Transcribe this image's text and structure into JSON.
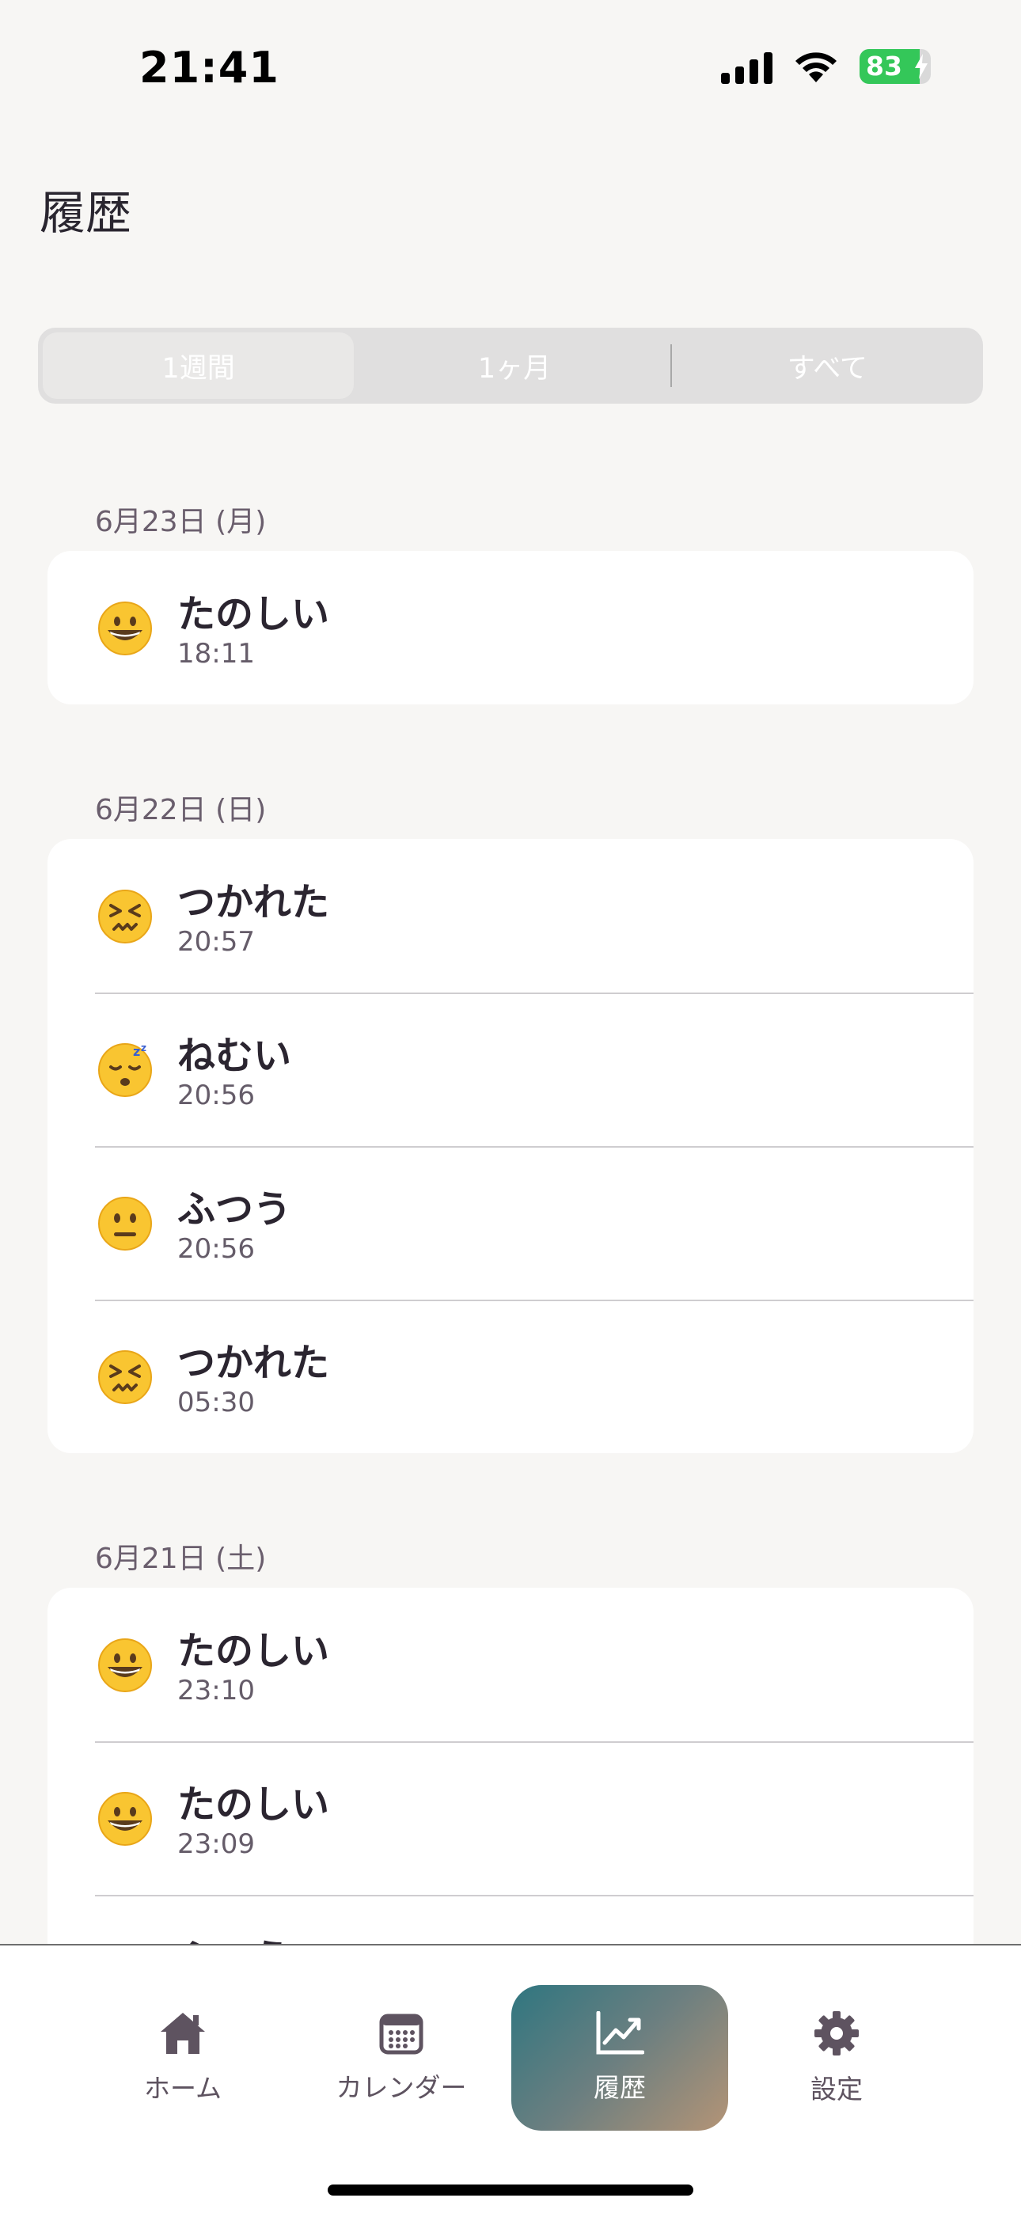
{
  "status_bar": {
    "time": "21:41",
    "battery": "83"
  },
  "header": {
    "title": "履歴"
  },
  "segments": {
    "week": "1週間",
    "month": "1ヶ月",
    "all": "すべて"
  },
  "sections": [
    {
      "date": "6月23日 (月)",
      "entries": [
        {
          "mood": "たのしい",
          "time": "18:11",
          "emoji": "grinning-face"
        }
      ]
    },
    {
      "date": "6月22日 (日)",
      "entries": [
        {
          "mood": "つかれた",
          "time": "20:57",
          "emoji": "confounded-face"
        },
        {
          "mood": "ねむい",
          "time": "20:56",
          "emoji": "sleeping-face"
        },
        {
          "mood": "ふつう",
          "time": "20:56",
          "emoji": "neutral-face"
        },
        {
          "mood": "つかれた",
          "time": "05:30",
          "emoji": "confounded-face"
        }
      ]
    },
    {
      "date": "6月21日 (土)",
      "entries": [
        {
          "mood": "たのしい",
          "time": "23:10",
          "emoji": "grinning-face"
        },
        {
          "mood": "たのしい",
          "time": "23:09",
          "emoji": "grinning-face"
        },
        {
          "mood": "ふつう",
          "time": "",
          "emoji": "neutral-face"
        }
      ]
    }
  ],
  "tabs": {
    "home": "ホーム",
    "calendar": "カレンダー",
    "history": "履歴",
    "settings": "設定"
  },
  "colors": {
    "accent_start": "#2f7680",
    "accent_end": "#b49476",
    "battery": "#34c759"
  }
}
